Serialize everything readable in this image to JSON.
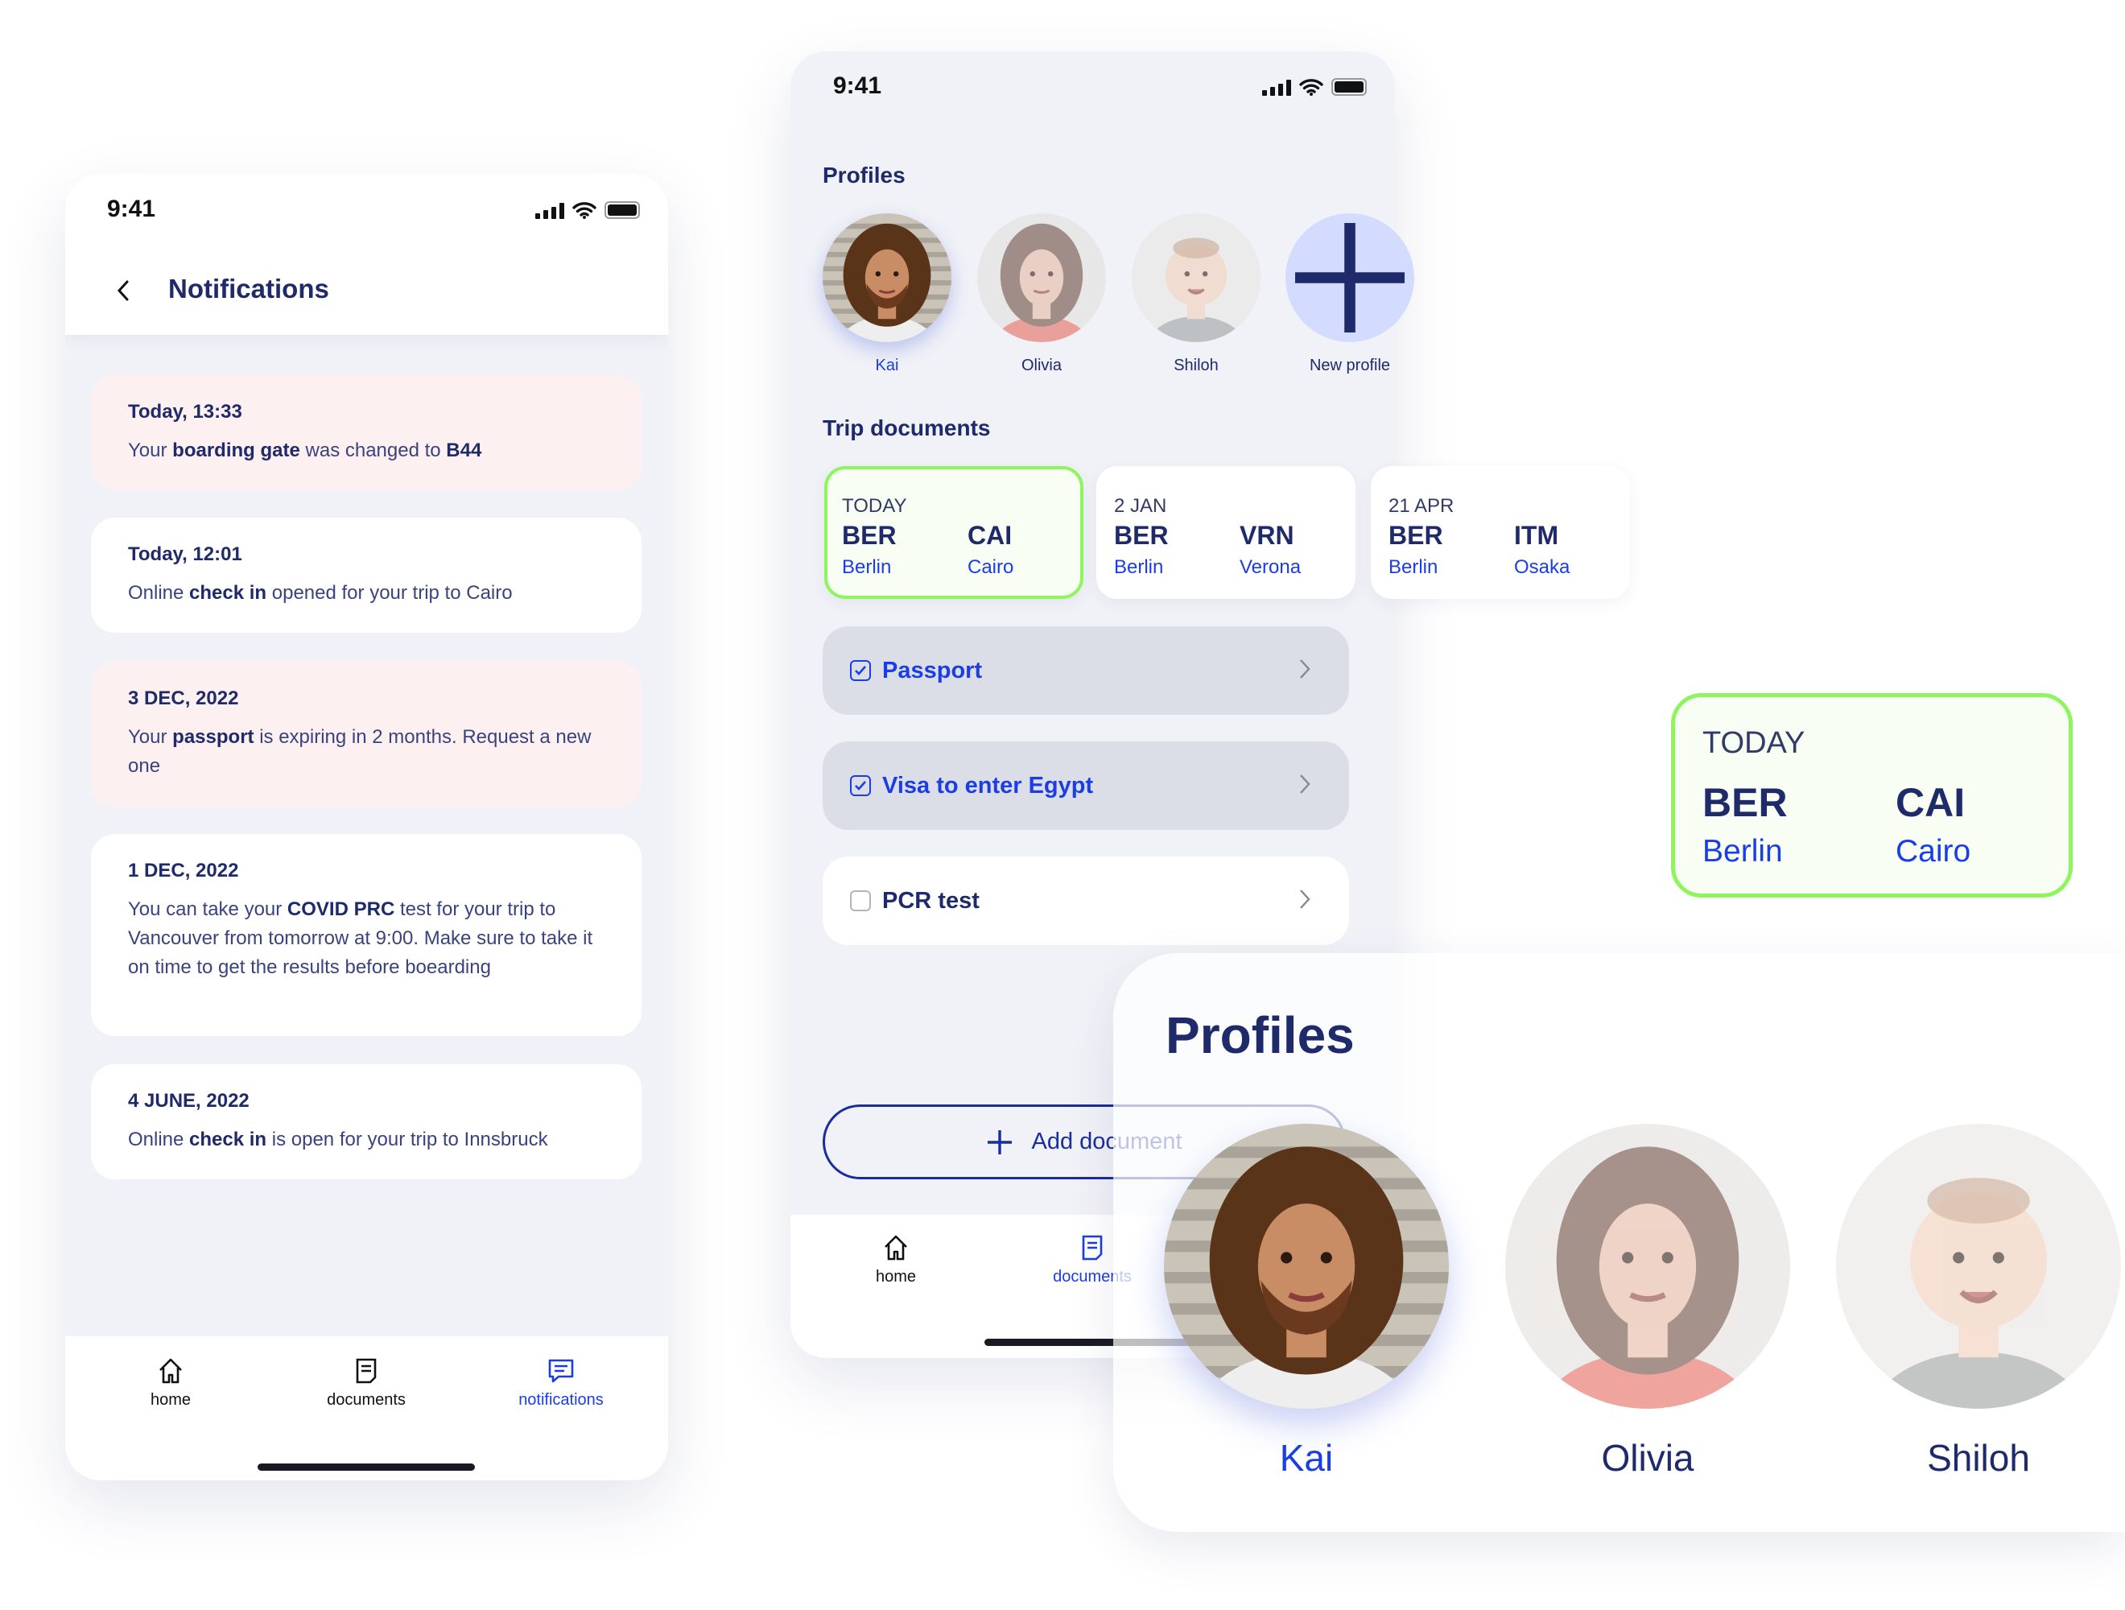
{
  "status_time": "9:41",
  "notifications_screen": {
    "title": "Notifications",
    "items": [
      {
        "date": "Today, 13:33",
        "parts": [
          "Your ",
          "boarding gate",
          " was changed to ",
          "B44"
        ],
        "highlight": true
      },
      {
        "date": "Today, 12:01",
        "parts": [
          "Online ",
          "check in",
          " opened for your trip to Cairo"
        ],
        "highlight": false
      },
      {
        "date": "3 DEC, 2022",
        "parts": [
          "Your ",
          "passport",
          " is expiring in 2 months. Request a new one"
        ],
        "highlight": true
      },
      {
        "date": "1 DEC, 2022",
        "parts": [
          "You can take your ",
          "COVID PRC",
          " test for your trip to Vancouver from tomorrow at 9:00. Make sure to take it on time to get the results before boearding"
        ],
        "highlight": false
      },
      {
        "date": "4 JUNE, 2022",
        "parts": [
          "Online ",
          "check in",
          " is open for your trip to Innsbruck"
        ],
        "highlight": false
      }
    ],
    "nav": [
      {
        "label": "home",
        "icon": "home-icon"
      },
      {
        "label": "documents",
        "icon": "document-icon"
      },
      {
        "label": "notifications",
        "icon": "chat-icon",
        "active": true
      }
    ]
  },
  "home_screen": {
    "profiles_title": "Profiles",
    "profiles": [
      {
        "name": "Kai",
        "active": true
      },
      {
        "name": "Olivia"
      },
      {
        "name": "Shiloh"
      }
    ],
    "new_profile_label": "New profile",
    "trip_documents_title": "Trip documents",
    "trips": [
      {
        "date": "TODAY",
        "from_code": "BER",
        "from_city": "Berlin",
        "to_code": "CAI",
        "to_city": "Cairo",
        "selected": true
      },
      {
        "date": "2 JAN",
        "from_code": "BER",
        "from_city": "Berlin",
        "to_code": "VRN",
        "to_city": "Verona"
      },
      {
        "date": "21 APR",
        "from_code": "BER",
        "from_city": "Berlin",
        "to_code": "ITM",
        "to_city": "Osaka"
      }
    ],
    "documents": [
      {
        "label": "Passport",
        "checked": true
      },
      {
        "label": "Visa to enter Egypt",
        "checked": true
      },
      {
        "label": "PCR test",
        "checked": false
      }
    ],
    "add_document_label": "Add document",
    "nav": [
      {
        "label": "home",
        "icon": "home-icon"
      },
      {
        "label": "documents",
        "icon": "document-icon",
        "active": true
      }
    ]
  },
  "trip_card_large": {
    "date": "TODAY",
    "from_code": "BER",
    "from_city": "Berlin",
    "to_code": "CAI",
    "to_city": "Cairo"
  },
  "profiles_panel": {
    "title": "Profiles",
    "profiles": [
      {
        "name": "Kai",
        "active": true
      },
      {
        "name": "Olivia"
      },
      {
        "name": "Shiloh"
      }
    ]
  },
  "colors": {
    "accent": "#1a3de6",
    "navy": "#1f2a6b",
    "selected_border": "#8ef55e",
    "alert_bg": "#fdf0f1"
  }
}
